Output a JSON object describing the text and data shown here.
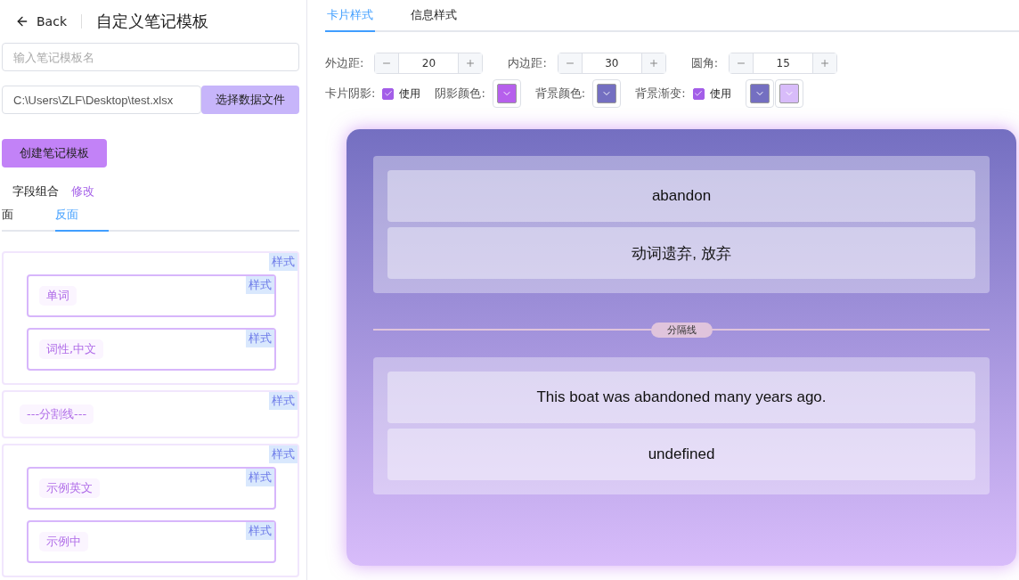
{
  "header": {
    "back": "Back",
    "title": "自定义笔记模板"
  },
  "name_input": {
    "placeholder": "输入笔记模板名"
  },
  "file_input": {
    "value": "C:\\Users\\ZLF\\Desktop\\test.xlsx"
  },
  "choose_button": "选择数据文件",
  "create_button": "创建笔记模板",
  "fields": {
    "label": "字段组合",
    "edit_link": "修改"
  },
  "side_tabs": [
    {
      "label": "面",
      "selected": false
    },
    {
      "label": "反面",
      "selected": true
    }
  ],
  "field_tree": [
    {
      "kind": "group",
      "badge": "样式",
      "children": [
        {
          "label": "单词",
          "badge": "样式"
        },
        {
          "label": "词性,中文",
          "badge": "样式"
        }
      ]
    },
    {
      "kind": "divider",
      "label": "---分割线---",
      "badge": "样式"
    },
    {
      "kind": "group",
      "badge": "样式",
      "children": [
        {
          "label": "示例英文",
          "badge": "样式"
        },
        {
          "label": "示例中",
          "badge": "样式"
        }
      ]
    }
  ],
  "style_tabs": [
    {
      "label": "卡片样式",
      "selected": true
    },
    {
      "label": "信息样式",
      "selected": false
    }
  ],
  "number_fields": [
    {
      "label": "外边距:",
      "value": "20"
    },
    {
      "label": "内边距:",
      "value": "30"
    },
    {
      "label": "圆角:",
      "value": "15"
    }
  ],
  "shadow": {
    "label": "卡片阴影:",
    "checked": true,
    "option": "使用"
  },
  "shadow_color": {
    "label": "阴影颜色:",
    "color": "#b660ec"
  },
  "background_color": {
    "label": "背景颜色:",
    "color": "#746fc1"
  },
  "gradient": {
    "label": "背景渐变:",
    "checked": true,
    "option": "使用",
    "stops": [
      {
        "color": "#746fc1"
      },
      {
        "color": "#d8bcfa"
      }
    ]
  },
  "preview": {
    "groups": [
      {
        "items": [
          "abandon",
          "动词遗弃, 放弃"
        ]
      },
      {
        "items": [
          "This boat was abandoned many years ago.",
          "undefined"
        ]
      }
    ],
    "divider": "分隔线"
  }
}
